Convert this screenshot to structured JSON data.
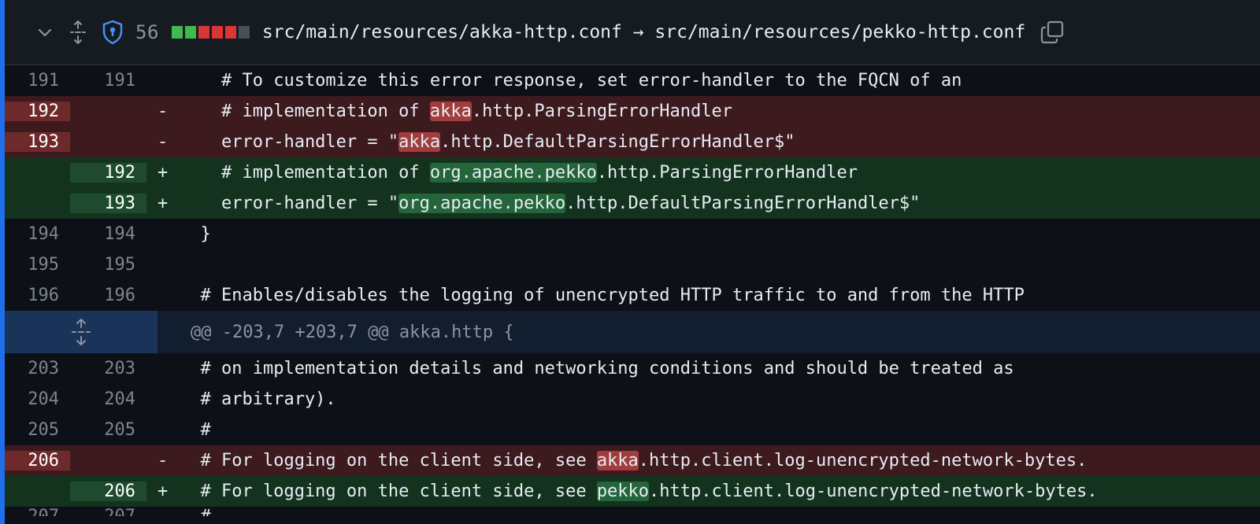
{
  "header": {
    "change_count": "56",
    "diffstat": [
      "added",
      "added",
      "removed",
      "removed",
      "removed",
      "neutral"
    ],
    "file_path": "src/main/resources/akka-http.conf → src/main/resources/pekko-http.conf",
    "icons": {
      "collapse": "chevron-down-icon",
      "expand": "expand-all-icon",
      "security": "shield-icon",
      "copy": "copy-icon"
    }
  },
  "colors": {
    "accent": "#1f6feb",
    "deletion": "#da3633",
    "addition": "#3fb950"
  },
  "rows": [
    {
      "type": "ctx",
      "old": "191",
      "new": "191",
      "marker": "",
      "pre": "    # To customize this error response, set error-handler to the FQCN of an",
      "hl": "",
      "post": ""
    },
    {
      "type": "del",
      "old": "192",
      "new": "",
      "marker": "-",
      "pre": "    # implementation of ",
      "hl": "akka",
      "post": ".http.ParsingErrorHandler"
    },
    {
      "type": "del",
      "old": "193",
      "new": "",
      "marker": "-",
      "pre": "    error-handler = \"",
      "hl": "akka",
      "post": ".http.DefaultParsingErrorHandler$\""
    },
    {
      "type": "add",
      "old": "",
      "new": "192",
      "marker": "+",
      "pre": "    # implementation of ",
      "hl": "org.apache.pekko",
      "post": ".http.ParsingErrorHandler"
    },
    {
      "type": "add",
      "old": "",
      "new": "193",
      "marker": "+",
      "pre": "    error-handler = \"",
      "hl": "org.apache.pekko",
      "post": ".http.DefaultParsingErrorHandler$\""
    },
    {
      "type": "ctx",
      "old": "194",
      "new": "194",
      "marker": "",
      "pre": "  }",
      "hl": "",
      "post": ""
    },
    {
      "type": "ctx",
      "old": "195",
      "new": "195",
      "marker": "",
      "pre": "",
      "hl": "",
      "post": ""
    },
    {
      "type": "ctx",
      "old": "196",
      "new": "196",
      "marker": "",
      "pre": "  # Enables/disables the logging of unencrypted HTTP traffic to and from the HTTP",
      "hl": "",
      "post": ""
    }
  ],
  "hunk": {
    "text": "@@ -203,7 +203,7 @@ akka.http {",
    "icon": "expand-icon"
  },
  "rows2": [
    {
      "type": "ctx",
      "old": "203",
      "new": "203",
      "marker": "",
      "pre": "  # on implementation details and networking conditions and should be treated as",
      "hl": "",
      "post": ""
    },
    {
      "type": "ctx",
      "old": "204",
      "new": "204",
      "marker": "",
      "pre": "  # arbitrary).",
      "hl": "",
      "post": ""
    },
    {
      "type": "ctx",
      "old": "205",
      "new": "205",
      "marker": "",
      "pre": "  #",
      "hl": "",
      "post": ""
    },
    {
      "type": "del",
      "old": "206",
      "new": "",
      "marker": "-",
      "pre": "  # For logging on the client side, see ",
      "hl": "akka",
      "post": ".http.client.log-unencrypted-network-bytes."
    },
    {
      "type": "add",
      "old": "",
      "new": "206",
      "marker": "+",
      "pre": "  # For logging on the client side, see ",
      "hl": "pekko",
      "post": ".http.client.log-unencrypted-network-bytes."
    },
    {
      "type": "ctx",
      "old": "207",
      "new": "207",
      "marker": "",
      "pre": "  #",
      "hl": "",
      "post": ""
    }
  ]
}
